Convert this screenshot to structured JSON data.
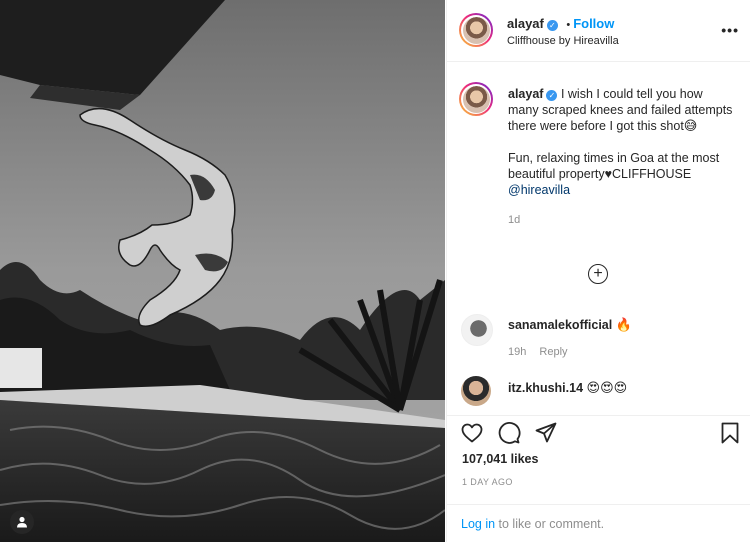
{
  "post": {
    "username": "alayaf",
    "follow_label": "Follow",
    "separator": "•",
    "location": "Cliffhouse by Hireavilla",
    "more_label": "•••"
  },
  "caption": {
    "username": "alayaf",
    "line1": "I wish I could tell you how many scraped knees and failed attempts there were before I got this shot",
    "emoji1": "😅",
    "line2": "Fun, relaxing times in Goa at the most beautiful property♥CLIFFHOUSE",
    "mention": "@hireavilla",
    "time": "1d"
  },
  "load_more_label": "+",
  "comments": [
    {
      "username": "sanamalekofficial",
      "text": "🔥",
      "time": "19h",
      "reply_label": "Reply"
    },
    {
      "username": "itz.khushi.14",
      "text": "😍😍😍"
    }
  ],
  "actions": {
    "likes": "107,041 likes",
    "date": "1 DAY AGO"
  },
  "login": {
    "link_label": "Log in",
    "rest_text": " to like or comment."
  },
  "icons": [
    "heart-icon",
    "comment-icon",
    "share-icon",
    "bookmark-icon",
    "user-tag-icon",
    "verified-icon",
    "add-circle-icon"
  ]
}
